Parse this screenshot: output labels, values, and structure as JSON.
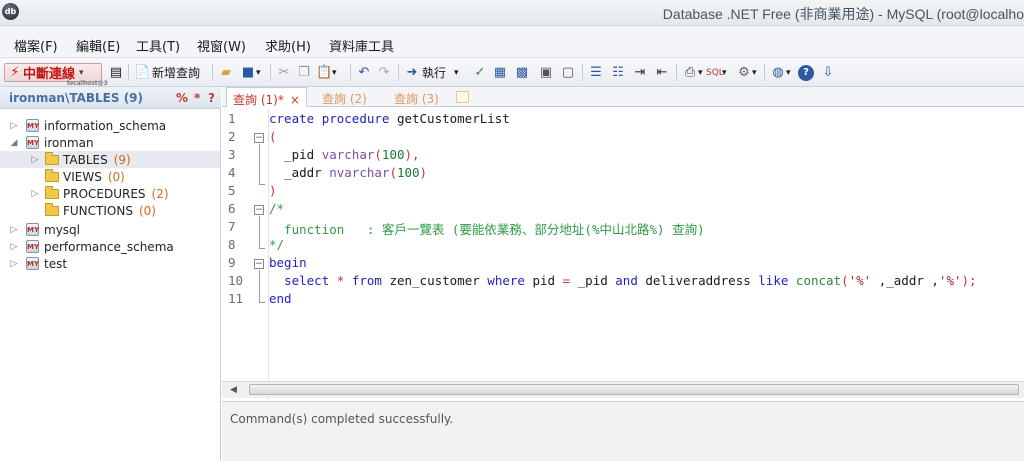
{
  "window": {
    "title": "Database .NET Free (非商業用途)   -  MySQL (root@localho",
    "app_icon": "dbnet-app-icon"
  },
  "menu": [
    "檔案(F)",
    "編輯(E)",
    "工具(T)",
    "視窗(W)",
    "求助(H)",
    "資料庫工具"
  ],
  "toolbar": {
    "disconnect_label": "中斷連線",
    "disconnect_sub": "localhost@3",
    "new_query_label": "新增查詢",
    "execute_label": "執行",
    "icons": [
      "disconnect-icon",
      "properties-icon",
      "new-query-icon",
      "open-folder-icon",
      "save-icon",
      "cut-icon",
      "copy-icon",
      "paste-icon",
      "undo-icon",
      "redo-icon",
      "execute-icon",
      "check-icon",
      "grid-icon",
      "snippet-icon",
      "format-icon",
      "indent-icon",
      "outdent-icon",
      "print-icon",
      "sql-icon",
      "settings-icon",
      "web-icon",
      "help-icon",
      "download-icon"
    ]
  },
  "tree": {
    "title": "ironman\\TABLES (9)",
    "tools": [
      "%",
      "*",
      "?"
    ],
    "items": [
      {
        "label": "information_schema",
        "count": "",
        "type": "database",
        "expander": "▷"
      },
      {
        "label": "ironman",
        "count": "",
        "type": "database",
        "expander": "◢"
      },
      {
        "label": "TABLES",
        "count": "(9)",
        "type": "folder",
        "expander": "▷"
      },
      {
        "label": "VIEWS",
        "count": "(0)",
        "type": "folder",
        "expander": ""
      },
      {
        "label": "PROCEDURES",
        "count": "(2)",
        "type": "folder",
        "expander": "▷"
      },
      {
        "label": "FUNCTIONS",
        "count": "(0)",
        "type": "folder",
        "expander": ""
      },
      {
        "label": "mysql",
        "count": "",
        "type": "database",
        "expander": "▷"
      },
      {
        "label": "performance_schema",
        "count": "",
        "type": "database",
        "expander": "▷"
      },
      {
        "label": "test",
        "count": "",
        "type": "database",
        "expander": "▷"
      }
    ]
  },
  "tabs": [
    {
      "label": "查詢 (1)*",
      "close": "×"
    },
    {
      "label": "查詢 (2)",
      "close": ""
    },
    {
      "label": "查詢 (3)",
      "close": ""
    }
  ],
  "editor": {
    "line_numbers": [
      "1",
      "2",
      "3",
      "4",
      "5",
      "6",
      "7",
      "8",
      "9",
      "10",
      "11"
    ],
    "code": {
      "l1_kw1": "create",
      "l1_kw2": "procedure",
      "l1_name": "getCustomerList",
      "l2": "(",
      "l3_name": "_pid ",
      "l3_type": "varchar",
      "l3_open": "(",
      "l3_num": "100",
      "l3_close": "),",
      "l4_name": "_addr ",
      "l4_type": "nvarchar",
      "l4_open": "(",
      "l4_num": "100",
      "l4_close": ")",
      "l5": ")",
      "l6": "/*",
      "l7": "  function   : 客戶一覽表 (要能依業務、部分地址(%中山北路%) 查詢)",
      "l8": "*/",
      "l9": "begin",
      "l10_select": "select",
      "l10_star": "*",
      "l10_from": "from",
      "l10_table": "zen_customer",
      "l10_where": "where",
      "l10_pid": "pid",
      "l10_eq": "=",
      "l10_ppid": "_pid",
      "l10_and": "and",
      "l10_col": "deliveraddress",
      "l10_like": "like",
      "l10_concat": "concat",
      "l10_args_open": "(",
      "l10_s1": "'%'",
      "l10_mid": " ,_addr ,",
      "l10_s2": "'%'",
      "l10_end": ");",
      "l11": "end"
    }
  },
  "output": {
    "message": "Command(s) completed successfully."
  }
}
